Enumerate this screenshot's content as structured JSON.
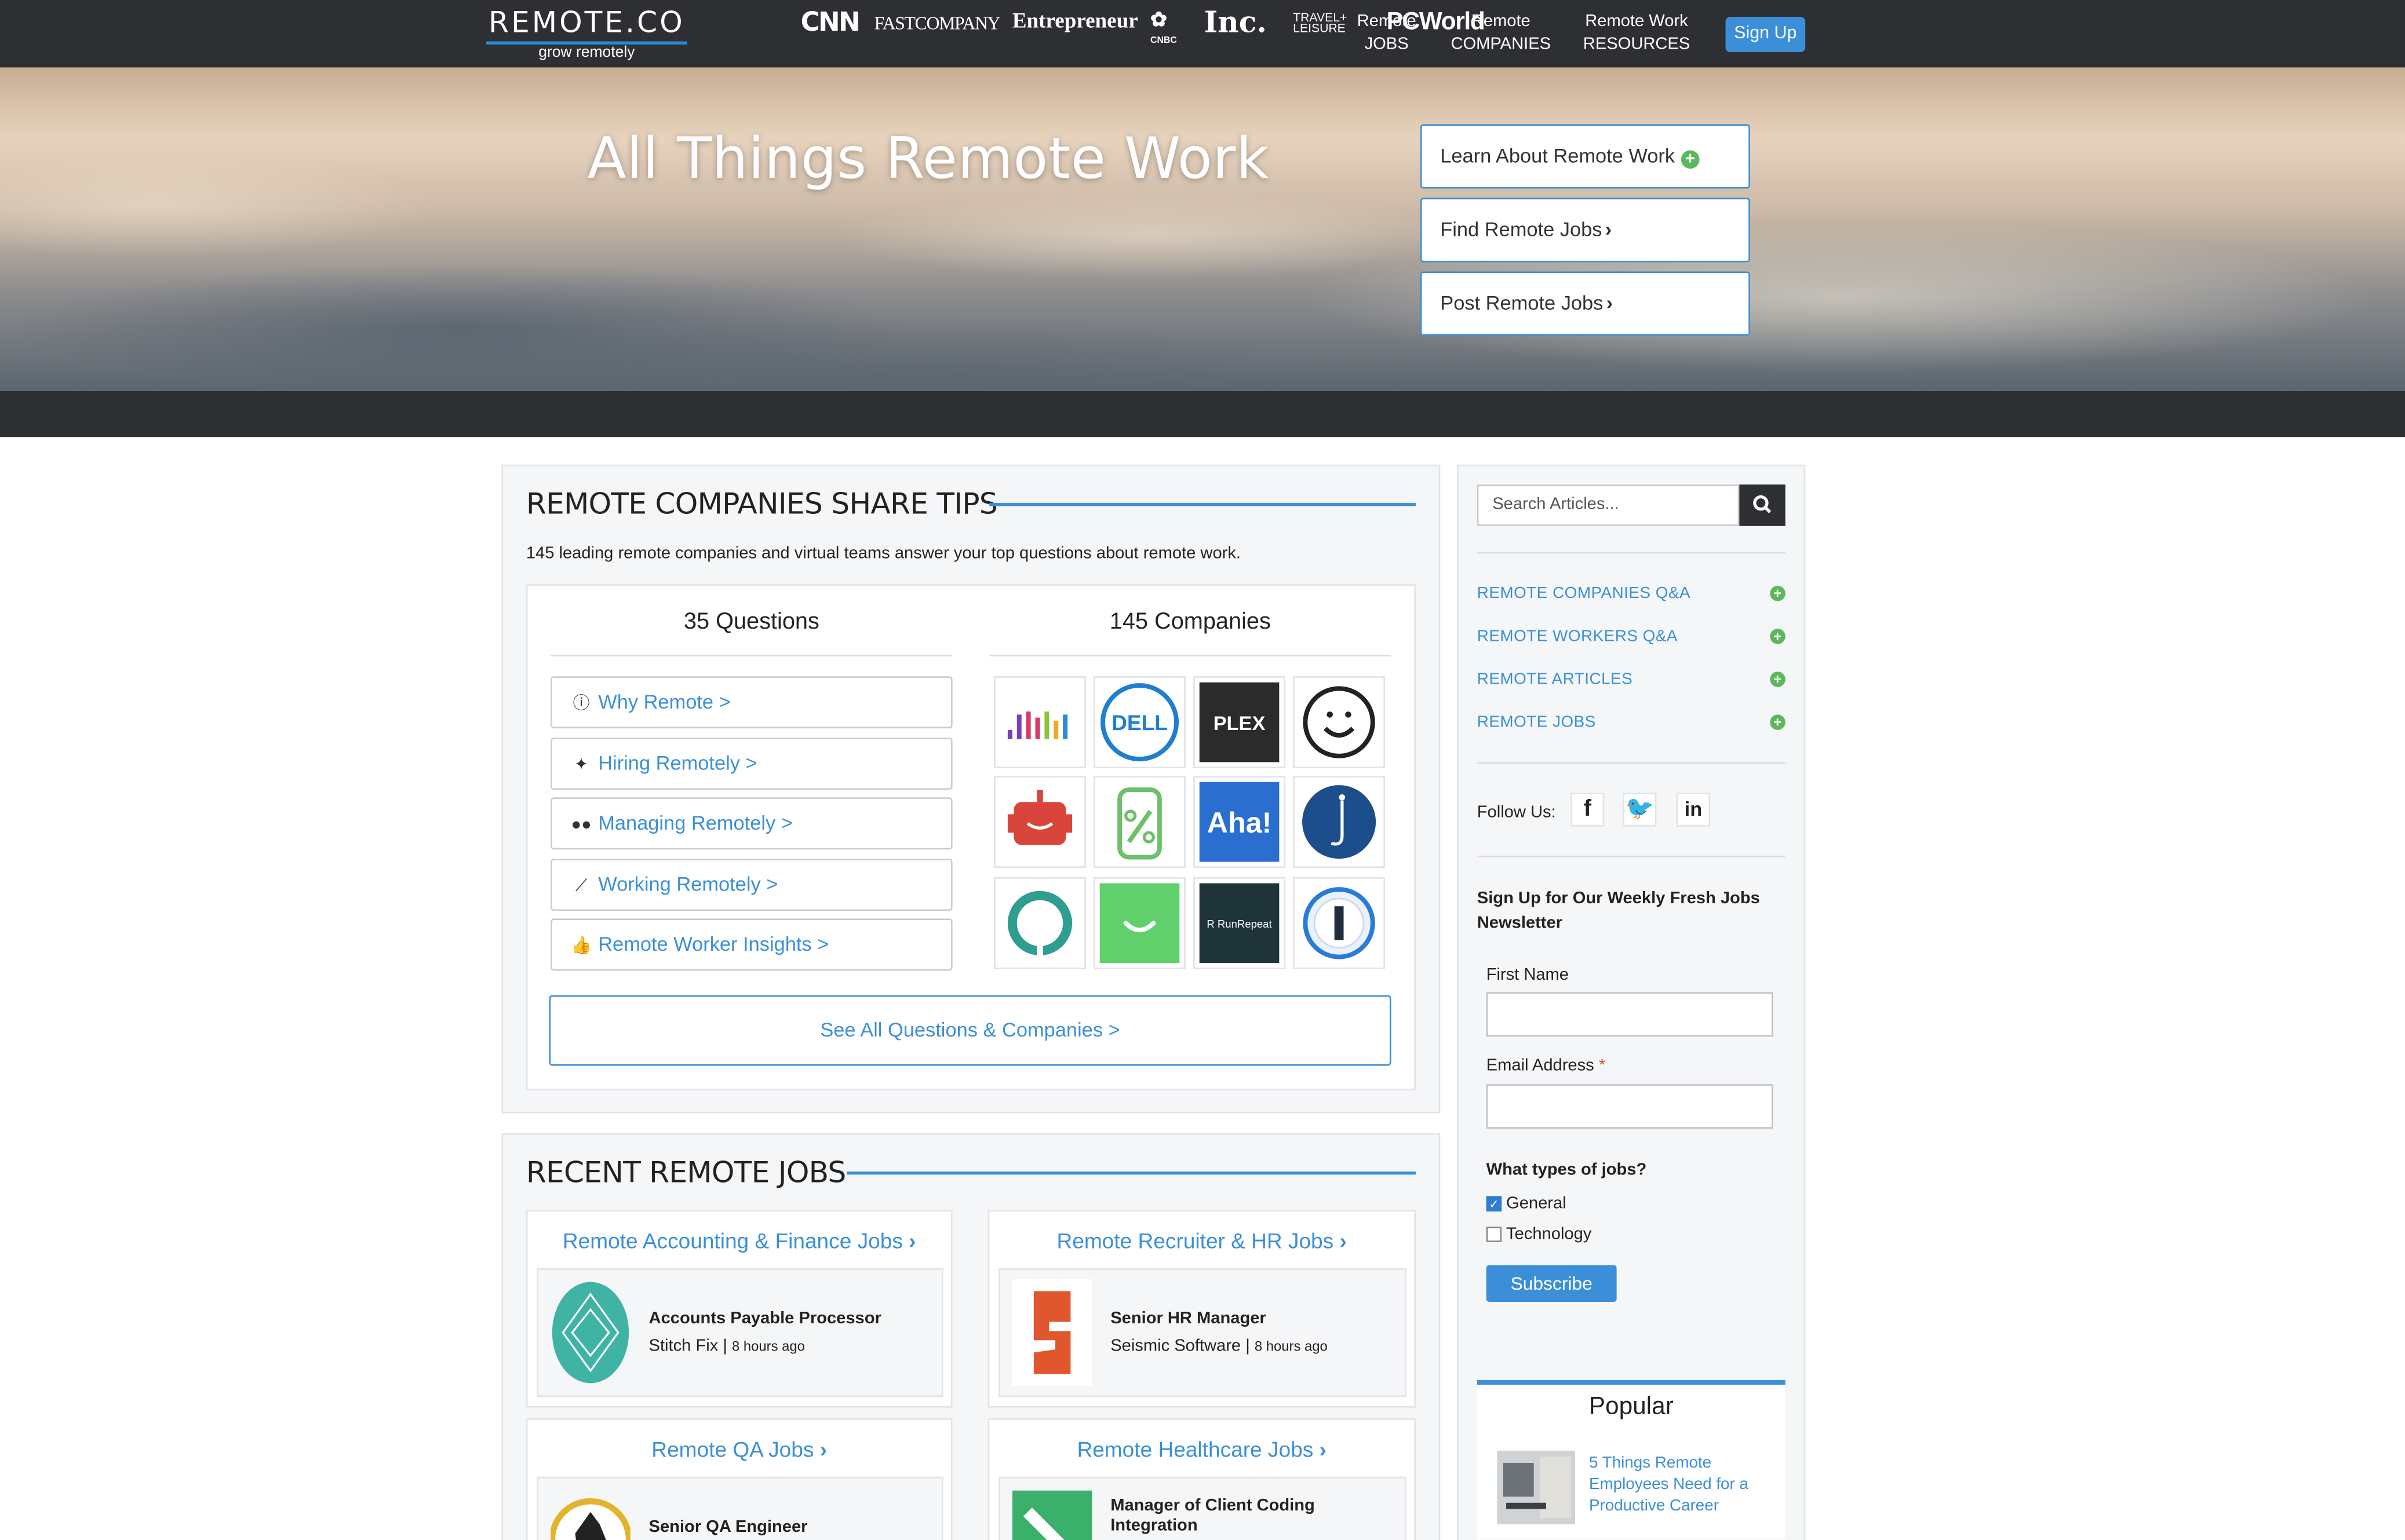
{
  "header": {
    "logo": "REMOTE.CO",
    "tagline": "grow remotely",
    "nav": [
      {
        "line1": "Remote",
        "line2": "JOBS"
      },
      {
        "line1": "Remote",
        "line2": "COMPANIES"
      },
      {
        "line1": "Remote Work",
        "line2": "RESOURCES"
      }
    ],
    "signup": "Sign Up"
  },
  "hero": {
    "title": "All Things Remote Work",
    "buttons": [
      {
        "label": "Learn About Remote Work",
        "icon": "plus-circle-icon"
      },
      {
        "label": "Find Remote Jobs",
        "icon": "chevron-right-icon"
      },
      {
        "label": "Post Remote Jobs",
        "icon": "chevron-right-icon"
      }
    ]
  },
  "press": [
    "CNN",
    "FASTCOMPANY",
    "Entrepreneur",
    "CNBC",
    "Inc.",
    "TRAVEL+ LEISURE",
    "PCWorld"
  ],
  "tips": {
    "heading": "REMOTE COMPANIES SHARE TIPS",
    "intro": "145 leading remote companies and virtual teams answer your top questions about remote work.",
    "questions_heading": "35 Questions",
    "companies_heading": "145 Companies",
    "questions": [
      {
        "label": "Why Remote >",
        "icon": "info-icon"
      },
      {
        "label": "Hiring Remotely >",
        "icon": "person-icon"
      },
      {
        "label": "Managing Remotely >",
        "icon": "users-icon"
      },
      {
        "label": "Working Remotely >",
        "icon": "chart-icon"
      },
      {
        "label": "Remote Worker Insights >",
        "icon": "thumbs-up-icon"
      }
    ],
    "company_logos": [
      "Ilm",
      "DELL",
      "PLEX",
      "smiley",
      "robot",
      "jar",
      "Aha!",
      "j",
      "ring",
      "smile",
      "RunRepeat",
      "1"
    ],
    "see_all": "See All Questions & Companies >"
  },
  "jobs": {
    "heading": "RECENT REMOTE JOBS",
    "cards": [
      {
        "category": "Remote Accounting & Finance Jobs",
        "title": "Accounts Payable Processor",
        "company": "Stitch Fix",
        "ago": "8 hours ago"
      },
      {
        "category": "Remote Recruiter & HR Jobs",
        "title": "Senior HR Manager",
        "company": "Seismic Software",
        "ago": "8 hours ago"
      },
      {
        "category": "Remote QA Jobs",
        "title": "Senior QA Engineer",
        "company": "",
        "ago": ""
      },
      {
        "category": "Remote Healthcare Jobs",
        "title": "Manager of Client Coding Integration",
        "company": "",
        "ago": ""
      }
    ]
  },
  "sidebar": {
    "search_placeholder": "Search Articles...",
    "links": [
      "REMOTE COMPANIES Q&A",
      "REMOTE WORKERS Q&A",
      "REMOTE ARTICLES",
      "REMOTE JOBS"
    ],
    "follow": "Follow Us:",
    "newsletter": {
      "heading": "Sign Up for Our Weekly Fresh Jobs Newsletter",
      "first_name": "First Name",
      "email": "Email Address",
      "required": "*",
      "types_heading": "What types of jobs?",
      "types": [
        {
          "label": "General",
          "checked": true
        },
        {
          "label": "Technology",
          "checked": false
        }
      ],
      "subscribe": "Subscribe"
    },
    "popular": {
      "heading": "Popular",
      "item": "5 Things Remote Employees Need for a Productive Career"
    }
  },
  "colors": {
    "accent": "#3b8fd8",
    "dark": "#2d2f32",
    "green": "#5cb85c"
  }
}
